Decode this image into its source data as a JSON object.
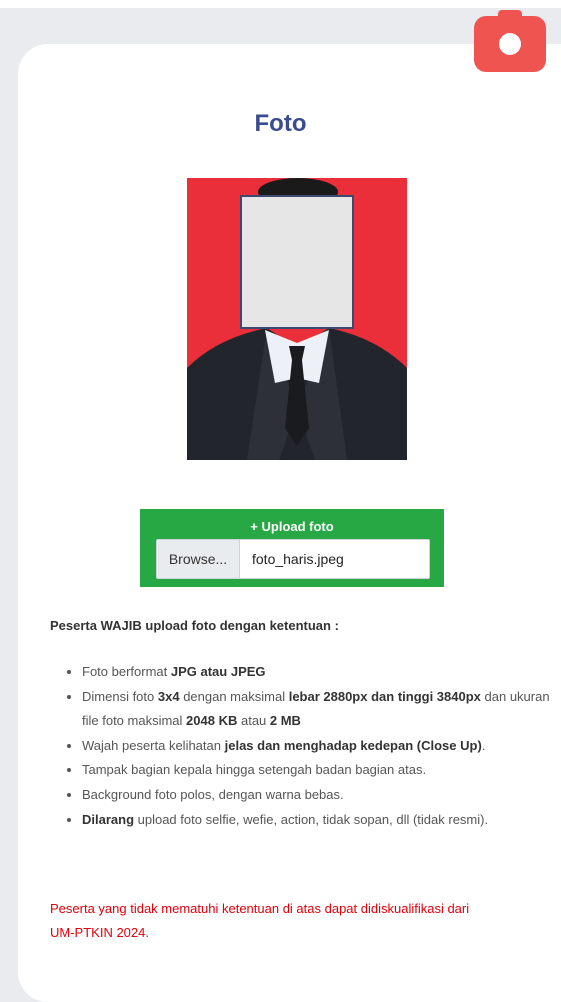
{
  "page": {
    "title": "Foto"
  },
  "photo": {
    "background_color": "#ea2f3a",
    "face_mask_color": "#e6e6e6"
  },
  "upload": {
    "label": "Upload foto",
    "plus_icon": "plus-icon",
    "browse_label": "Browse...",
    "file_name": "foto_haris.jpeg",
    "accent_color": "#28a745"
  },
  "camera_button": {
    "icon": "camera-icon",
    "color": "#ef5450"
  },
  "requirements": {
    "heading": "Peserta WAJIB upload foto dengan ketentuan :",
    "items": [
      {
        "text": "Foto berformat ",
        "bold": "JPG atau JPEG"
      },
      {
        "parts": [
          {
            "t": "Dimensi foto "
          },
          {
            "b": "3x4"
          },
          {
            "t": " dengan maksimal "
          },
          {
            "b": "lebar 2880px dan tinggi 3840px"
          },
          {
            "t": " dan ukuran file foto maksimal "
          },
          {
            "b": "2048 KB"
          },
          {
            "t": " atau "
          },
          {
            "b": "2 MB"
          }
        ]
      },
      {
        "parts": [
          {
            "t": "Wajah peserta kelihatan "
          },
          {
            "b": "jelas dan menghadap kedepan (Close Up)"
          },
          {
            "t": "."
          }
        ]
      },
      {
        "parts": [
          {
            "t": "Tampak bagian kepala hingga setengah badan bagian atas."
          }
        ]
      },
      {
        "parts": [
          {
            "t": "Background foto polos, dengan warna bebas."
          }
        ]
      },
      {
        "parts": [
          {
            "b": "Dilarang"
          },
          {
            "t": " upload foto selfie, wefie, action, tidak sopan, dll (tidak resmi)."
          }
        ]
      }
    ]
  },
  "warning": "Peserta yang tidak mematuhi ketentuan di atas dapat didiskualifikasi dari UM-PTKIN 2024.",
  "colors": {
    "title": "#3a4b8f",
    "warning": "#e3000b",
    "camera": "#ef5450"
  }
}
